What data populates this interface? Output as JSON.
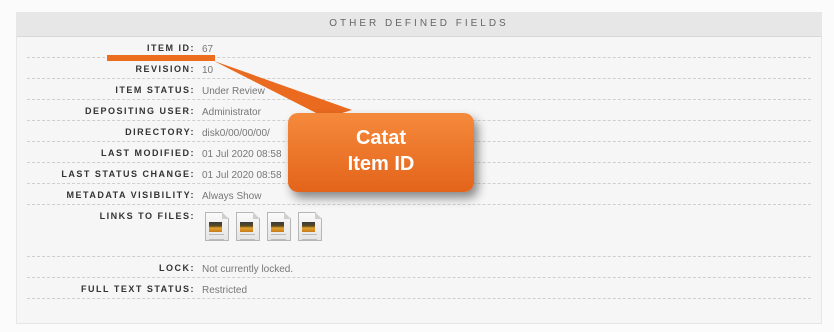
{
  "panel": {
    "title": "OTHER DEFINED FIELDS"
  },
  "fields": {
    "item_id": {
      "label": "ITEM ID:",
      "value": "67"
    },
    "revision": {
      "label": "REVISION:",
      "value": "10"
    },
    "item_status": {
      "label": "ITEM STATUS:",
      "value": "Under Review"
    },
    "depositing_user": {
      "label": "DEPOSITING USER:",
      "value": "Administrator"
    },
    "directory": {
      "label": "DIRECTORY:",
      "value": "disk0/00/00/00/"
    },
    "last_modified": {
      "label": "LAST MODIFIED:",
      "value": "01 Jul 2020 08:58"
    },
    "last_status_change": {
      "label": "LAST STATUS CHANGE:",
      "value": "01 Jul 2020 08:58"
    },
    "metadata_visibility": {
      "label": "METADATA VISIBILITY:",
      "value": "Always Show"
    },
    "links_to_files": {
      "label": "LINKS TO FILES:",
      "icons": [
        "document-image-icon",
        "document-image-icon",
        "document-image-icon",
        "document-image-icon"
      ]
    },
    "lock": {
      "label": "LOCK:",
      "value": "Not currently locked."
    },
    "full_text_status": {
      "label": "FULL TEXT STATUS:",
      "value": "Restricted"
    }
  },
  "annotation": {
    "callout_line1": "Catat",
    "callout_line2": "Item ID",
    "color": "#ec6d1e"
  }
}
